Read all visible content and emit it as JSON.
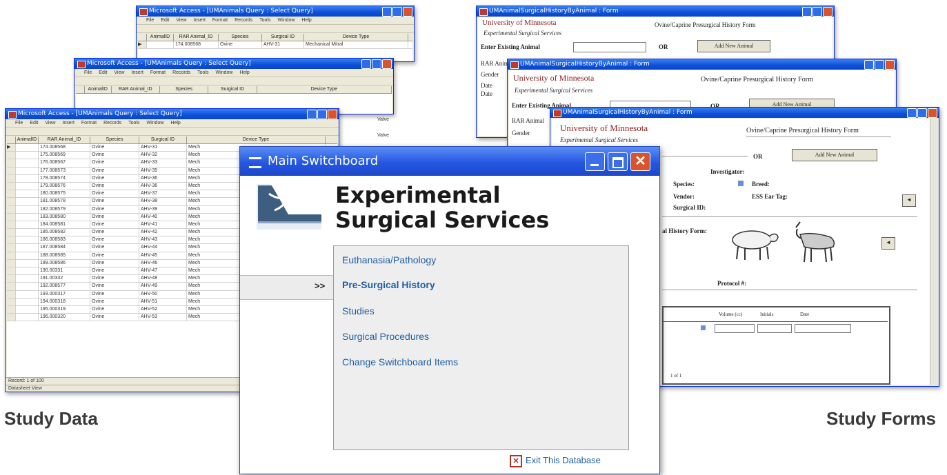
{
  "colors": {
    "accent": "#1d5fa3",
    "titlebar": "#2457e2",
    "close": "#d9532c",
    "label": "#3a3a3a"
  },
  "labels": {
    "left": "Study Data",
    "right": "Study Forms"
  },
  "access": {
    "title": "Microsoft Access - [UMAnimals Query : Select Query]",
    "menu": [
      "File",
      "Edit",
      "View",
      "Insert",
      "Format",
      "Records",
      "Tools",
      "Window",
      "Help"
    ],
    "columns": [
      "AnimalID",
      "RAR Animal_ID",
      "Species",
      "Surgical ID",
      "Device Type"
    ],
    "front_rows": [
      {
        "id": "174.008568",
        "sp": "Ovine",
        "sur": "AHV-31",
        "dev": "Mech"
      },
      {
        "id": "175.008569",
        "sp": "Ovine",
        "sur": "AHV-32",
        "dev": "Mech"
      },
      {
        "id": "176.008567",
        "sp": "Ovine",
        "sur": "AHV-33",
        "dev": "Mech"
      },
      {
        "id": "177.008573",
        "sp": "Ovine",
        "sur": "AHV-35",
        "dev": "Mech"
      },
      {
        "id": "178.008574",
        "sp": "Ovine",
        "sur": "AHV-36",
        "dev": "Mech"
      },
      {
        "id": "179.008576",
        "sp": "Ovine",
        "sur": "AHV-36",
        "dev": "Mech"
      },
      {
        "id": "180.008575",
        "sp": "Ovine",
        "sur": "AHV-37",
        "dev": "Mech"
      },
      {
        "id": "181.008578",
        "sp": "Ovine",
        "sur": "AHV-38",
        "dev": "Mech"
      },
      {
        "id": "182.008579",
        "sp": "Ovine",
        "sur": "AHV-39",
        "dev": "Mech"
      },
      {
        "id": "183.008580",
        "sp": "Ovine",
        "sur": "AHV-40",
        "dev": "Mech"
      },
      {
        "id": "184.008581",
        "sp": "Ovine",
        "sur": "AHV-41",
        "dev": "Mech"
      },
      {
        "id": "185.008582",
        "sp": "Ovine",
        "sur": "AHV-42",
        "dev": "Mech"
      },
      {
        "id": "186.008583",
        "sp": "Ovine",
        "sur": "AHV-43",
        "dev": "Mech"
      },
      {
        "id": "187.008584",
        "sp": "Ovine",
        "sur": "AHV-44",
        "dev": "Mech"
      },
      {
        "id": "188.008585",
        "sp": "Ovine",
        "sur": "AHV-45",
        "dev": "Mech"
      },
      {
        "id": "189.008586",
        "sp": "Ovine",
        "sur": "AHV-46",
        "dev": "Mech"
      },
      {
        "id": "190.00331",
        "sp": "Ovine",
        "sur": "AHV-47",
        "dev": "Mech"
      },
      {
        "id": "191.00332",
        "sp": "Ovine",
        "sur": "AHV-48",
        "dev": "Mech"
      },
      {
        "id": "192.008577",
        "sp": "Ovine",
        "sur": "AHV-49",
        "dev": "Mech"
      },
      {
        "id": "193.000317",
        "sp": "Ovine",
        "sur": "AHV-50",
        "dev": "Mech"
      },
      {
        "id": "194.000318",
        "sp": "Ovine",
        "sur": "AHV-51",
        "dev": "Mech"
      },
      {
        "id": "195.000319",
        "sp": "Ovine",
        "sur": "AHV-52",
        "dev": "Mech"
      },
      {
        "id": "196.000320",
        "sp": "Ovine",
        "sur": "AHV-53",
        "dev": "Mech"
      }
    ],
    "back_row": {
      "id": "174.008568",
      "sp": "Ovine",
      "sur": "AHV-31",
      "dev": "Mechanical Mitral"
    },
    "side_values": [
      "Valve",
      "Valve"
    ],
    "record_nav": "Record: 1 of 100",
    "status": "Datasheet View"
  },
  "form": {
    "title": "UMAnimalSurgicalHistoryByAnimal : Form",
    "university": "University of Minnesota",
    "dept": "Experimental Surgical Services",
    "form_name": "Ovine/Caprine Presurgical History Form",
    "enter_existing": "Enter Existing Animal",
    "or": "OR",
    "add_new": "Add New Animal",
    "rar": "RAR Animal",
    "gender": "Gender",
    "date": "Date",
    "investigator": "Investigator:",
    "species": "Species:",
    "breed": "Breed:",
    "vendor": "Vendor:",
    "ear_tag": "ESS Ear Tag:",
    "surgical_id": "Surgical ID:",
    "history_label": "al History Form:",
    "protocol": "Protocol #:",
    "sub_cols": [
      "Volume (cc)",
      "Initials",
      "Date"
    ],
    "record_nav": "1 of 1"
  },
  "switchboard": {
    "title": "Main Switchboard",
    "heading_line1": "Experimental",
    "heading_line2": "Surgical Services",
    "pointer": ">>",
    "items": [
      "Euthanasia/Pathology",
      "Pre-Surgical History",
      "Studies",
      "Surgical Procedures",
      "Change Switchboard Items"
    ],
    "exit_label": "Exit This Database"
  }
}
